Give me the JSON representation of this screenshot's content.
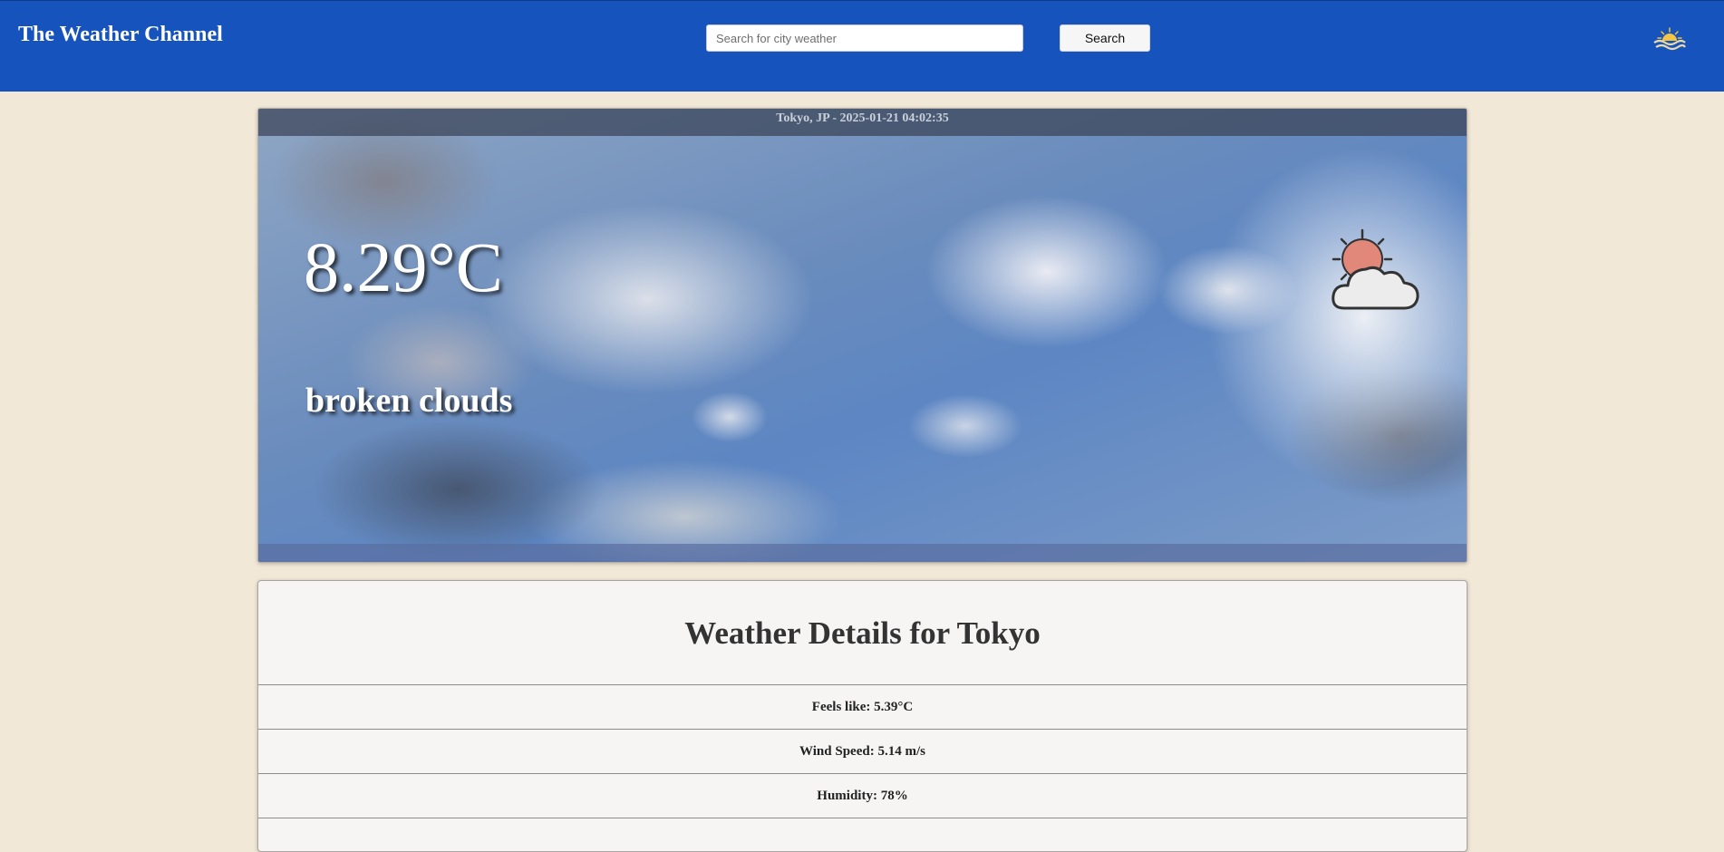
{
  "header": {
    "brand": "The Weather Channel",
    "search_placeholder": "Search for city weather",
    "search_value": "",
    "search_button": "Search",
    "logo_icon": "sun-over-waves-icon"
  },
  "current": {
    "location_time": "Tokyo, JP - 2025-01-21 04:02:35",
    "temperature": "8.29°C",
    "description": "broken clouds",
    "icon": "partly-cloudy-icon"
  },
  "details": {
    "title": "Weather Details for Tokyo",
    "rows": [
      {
        "text": "Feels like: 5.39°C"
      },
      {
        "text": "Wind Speed: 5.14 m/s"
      },
      {
        "text": "Humidity: 78%"
      }
    ]
  },
  "colors": {
    "header_bg": "#1653bd",
    "page_bg": "#f2e8d8",
    "card_bg": "#f6f5f3",
    "sun": "#e2887a"
  }
}
